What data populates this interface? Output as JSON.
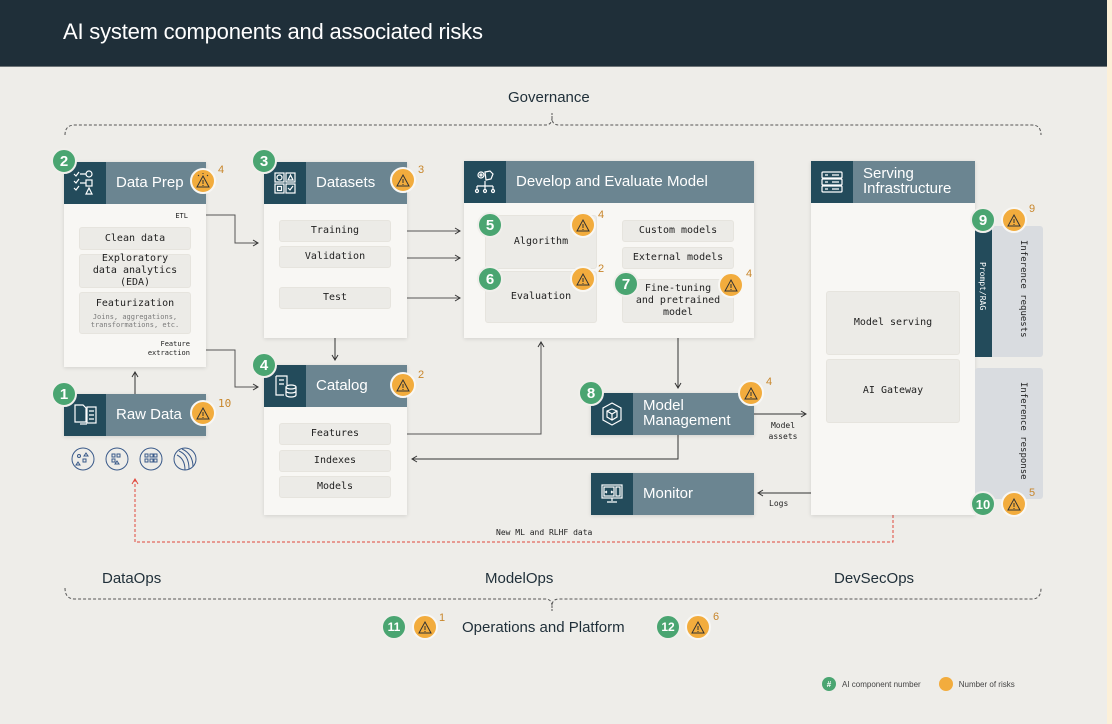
{
  "title": "AI system components and associated risks",
  "governance_label": "Governance",
  "ops_labels": {
    "dataops": "DataOps",
    "modelops": "ModelOps",
    "devsecops": "DevSecOps"
  },
  "operations": {
    "label": "Operations and Platform",
    "components": [
      {
        "number": "11",
        "risks": "1"
      },
      {
        "number": "12",
        "risks": "6"
      }
    ]
  },
  "colors": {
    "component_green": "#4aa571",
    "risk_orange": "#f2ac3d",
    "header_dark": "#234b5b",
    "header_light": "#6b8591",
    "feedback_red": "#e0473c"
  },
  "raw_data": {
    "number": "1",
    "title": "Raw Data",
    "risks": "10",
    "icon": "raw-data-icon",
    "sources": [
      "unstructured-data-icon",
      "semi-structured-data-icon",
      "structured-data-icon",
      "streaming-data-icon"
    ]
  },
  "data_prep": {
    "number": "2",
    "title": "Data Prep",
    "risks": "4",
    "icon": "data-prep-icon",
    "etl_label": "ETL",
    "items": [
      {
        "label": "Clean data"
      },
      {
        "label": "Exploratory data analytics (EDA)"
      },
      {
        "label": "Featurization",
        "sub": "Joins, aggregations, transformations, etc."
      }
    ],
    "feature_extraction_label": "Feature extraction"
  },
  "datasets": {
    "number": "3",
    "title": "Datasets",
    "risks": "3",
    "items": [
      "Training",
      "Validation",
      "Test"
    ]
  },
  "catalog": {
    "number": "4",
    "title": "Catalog",
    "risks": "2",
    "items": [
      "Features",
      "Indexes",
      "Models"
    ]
  },
  "develop": {
    "title": "Develop and Evaluate Model",
    "algorithm": {
      "number": "5",
      "label": "Algorithm",
      "risks": "4"
    },
    "evaluation": {
      "number": "6",
      "label": "Evaluation",
      "risks": "2"
    },
    "custom_models": "Custom models",
    "external_models": "External models",
    "fine_tuning": {
      "number": "7",
      "label": "Fine-tuning and pretrained model",
      "risks": "4"
    }
  },
  "model_management": {
    "number": "8",
    "title": "Model Management",
    "risks": "4",
    "assets_label": "Model assets"
  },
  "monitor": {
    "title": "Monitor",
    "logs_label": "Logs"
  },
  "serving": {
    "title": "Serving Infrastructure",
    "items": [
      "Model serving",
      "AI Gateway"
    ],
    "prompt": {
      "number": "9",
      "label": "Prompt/RAG",
      "risks": "9",
      "requests_label": "Inference requests"
    },
    "response": {
      "number": "10",
      "risks": "5",
      "label": "Inference response"
    }
  },
  "feedback_label": "New ML and RLHF data",
  "legend": {
    "component_symbol": "#",
    "component_label": "AI component number",
    "risk_label": "Number of risks"
  }
}
